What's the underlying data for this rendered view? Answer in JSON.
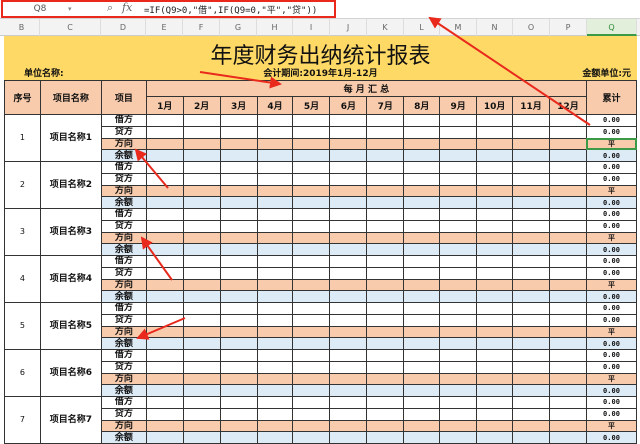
{
  "formula_bar": {
    "name_box": "Q8",
    "fx_label": "fx",
    "formula": "=IF(Q9>0,\"借\",IF(Q9=0,\"平\",\"贷\"))"
  },
  "columns": [
    "B",
    "C",
    "D",
    "E",
    "F",
    "G",
    "H",
    "I",
    "J",
    "K",
    "L",
    "M",
    "N",
    "O",
    "P",
    "Q"
  ],
  "selected_column": "Q",
  "report": {
    "title": "年度财务出纳统计报表",
    "unit_name_label": "单位名称:",
    "period": "会计期间:2019年1月-12月",
    "currency_unit": "金额单位:元",
    "headers": {
      "seq": "序号",
      "project_name": "项目名称",
      "item": "项目",
      "monthly": "每 月 汇 总",
      "total": "累计"
    },
    "months": [
      "1月",
      "2月",
      "3月",
      "4月",
      "5月",
      "6月",
      "7月",
      "8月",
      "9月",
      "10月",
      "11月",
      "12月"
    ],
    "sub_items": [
      "借方",
      "贷方",
      "方向",
      "余额"
    ],
    "projects": [
      {
        "seq": "1",
        "name": "项目名称1",
        "totals": [
          "0.00",
          "0.00",
          "平",
          "0.00"
        ]
      },
      {
        "seq": "2",
        "name": "项目名称2",
        "totals": [
          "0.00",
          "0.00",
          "平",
          "0.00"
        ]
      },
      {
        "seq": "3",
        "name": "项目名称3",
        "totals": [
          "0.00",
          "0.00",
          "平",
          "0.00"
        ]
      },
      {
        "seq": "4",
        "name": "项目名称4",
        "totals": [
          "0.00",
          "0.00",
          "平",
          "0.00"
        ]
      },
      {
        "seq": "5",
        "name": "项目名称5",
        "totals": [
          "0.00",
          "0.00",
          "平",
          "0.00"
        ]
      },
      {
        "seq": "6",
        "name": "项目名称6",
        "totals": [
          "0.00",
          "0.00",
          "平",
          "0.00"
        ]
      },
      {
        "seq": "7",
        "name": "项目名称7",
        "totals": [
          "0.00",
          "0.00",
          "平",
          "0.00"
        ]
      }
    ]
  },
  "colors": {
    "title_bg": "#ffd966",
    "header_bg": "#f8cbad",
    "balance_bg": "#ddebf7",
    "annotation": "#e8291c"
  }
}
